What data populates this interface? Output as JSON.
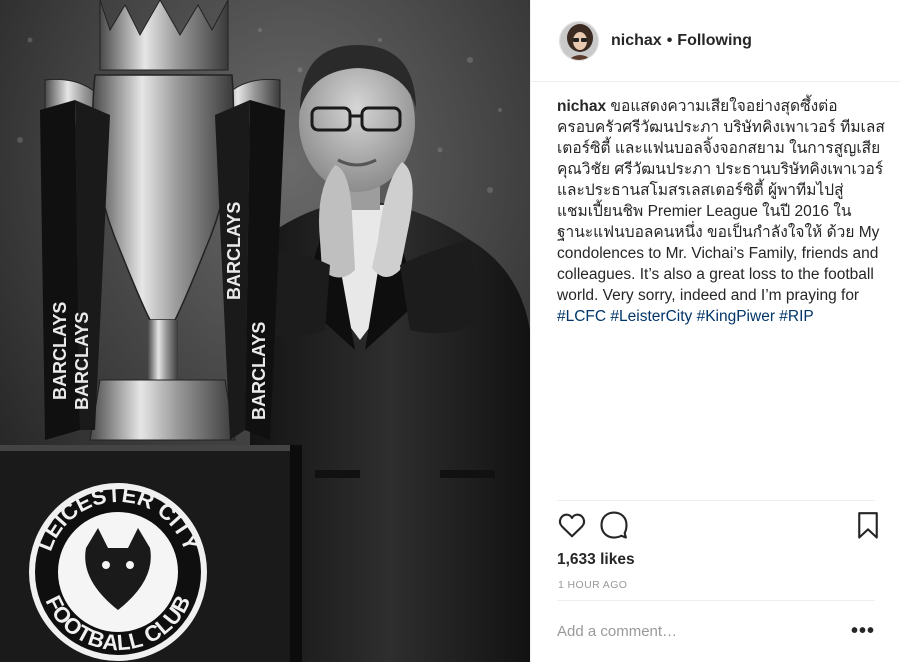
{
  "post": {
    "image_alt": "Black and white photo of a man applauding beside the Premier League trophy and a Leicester City Football Club crest",
    "crest_text_top": "LEICESTER CITY",
    "crest_text_bottom": "FOOTBALL CLUB",
    "ribbon_text": "BARCLAYS"
  },
  "header": {
    "username": "nichax",
    "separator": "•",
    "follow_status": "Following",
    "avatar_icon": "profile-avatar-icon"
  },
  "caption": {
    "username": "nichax",
    "text": " ขอแสดงความเสียใจอย่างสุดซึ้งต่อครอบครัวศรีวัฒนประภา บริษัทคิงเพาเวอร์ ทีมเลสเตอร์ซิตี้ และแฟนบอลจิ้งจอกสยาม ในการสูญเสียคุณวิชัย ศรีวัฒนประภา ประธานบริษัทคิงเพาเวอร์และประธานสโมสรเลสเตอร์ซิตี้ ผู้พาทีมไปสู่แชมเปี้ยนชิพ Premier League ในปี 2016 ในฐานะแฟนบอลคนหนึ่ง ขอเป็นกำลังใจให้ ด้วย My condolences to Mr. Vichai’s Family, friends and colleagues. It’s also a great loss to the football world. Very sorry, indeed and I’m praying for ",
    "hashtags": [
      "#LCFC",
      "#LeisterCity",
      "#KingPiwer",
      "#RIP"
    ]
  },
  "actions": {
    "like_icon": "heart-icon",
    "comment_icon": "comment-bubble-icon",
    "save_icon": "bookmark-icon"
  },
  "likes": "1,633 likes",
  "timestamp": "1 HOUR AGO",
  "comment_box": {
    "placeholder": "Add a comment…",
    "more_label": "•••"
  },
  "colors": {
    "text": "#262626",
    "hashtag": "#003569",
    "muted": "#999999",
    "divider": "#efefef"
  }
}
